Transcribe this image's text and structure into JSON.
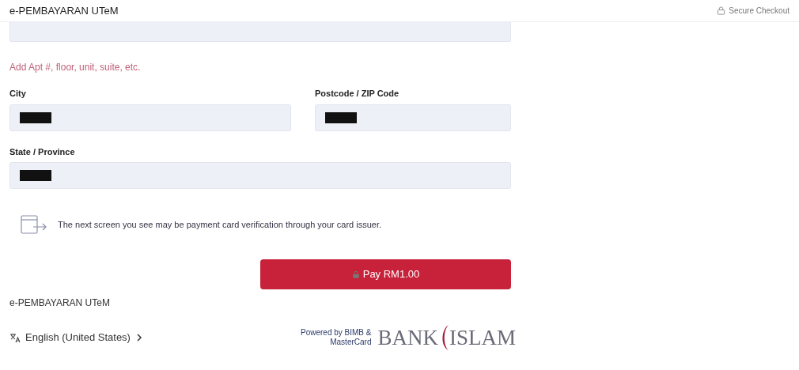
{
  "header": {
    "title": "e-PEMBAYARAN UTeM",
    "secure": "Secure Checkout"
  },
  "address_link": "Add Apt #, floor, unit, suite, etc.",
  "fields": [
    {
      "label": "City",
      "redacted": true
    },
    {
      "label": "Postcode / ZIP Code",
      "redacted": true
    },
    {
      "label": "State / Province",
      "redacted": true
    }
  ],
  "notice": "The next screen you see may be payment card verification through your card issuer.",
  "pay_button": "Pay RM1.00",
  "footer": {
    "merchant": "e-PEMBAYARAN UTeM",
    "language": "English (United States)",
    "powered_by": "Powered by BIMB &",
    "powered_by_2": "MasterCard",
    "logo_left": "BANK",
    "logo_right": "ISLAM"
  }
}
